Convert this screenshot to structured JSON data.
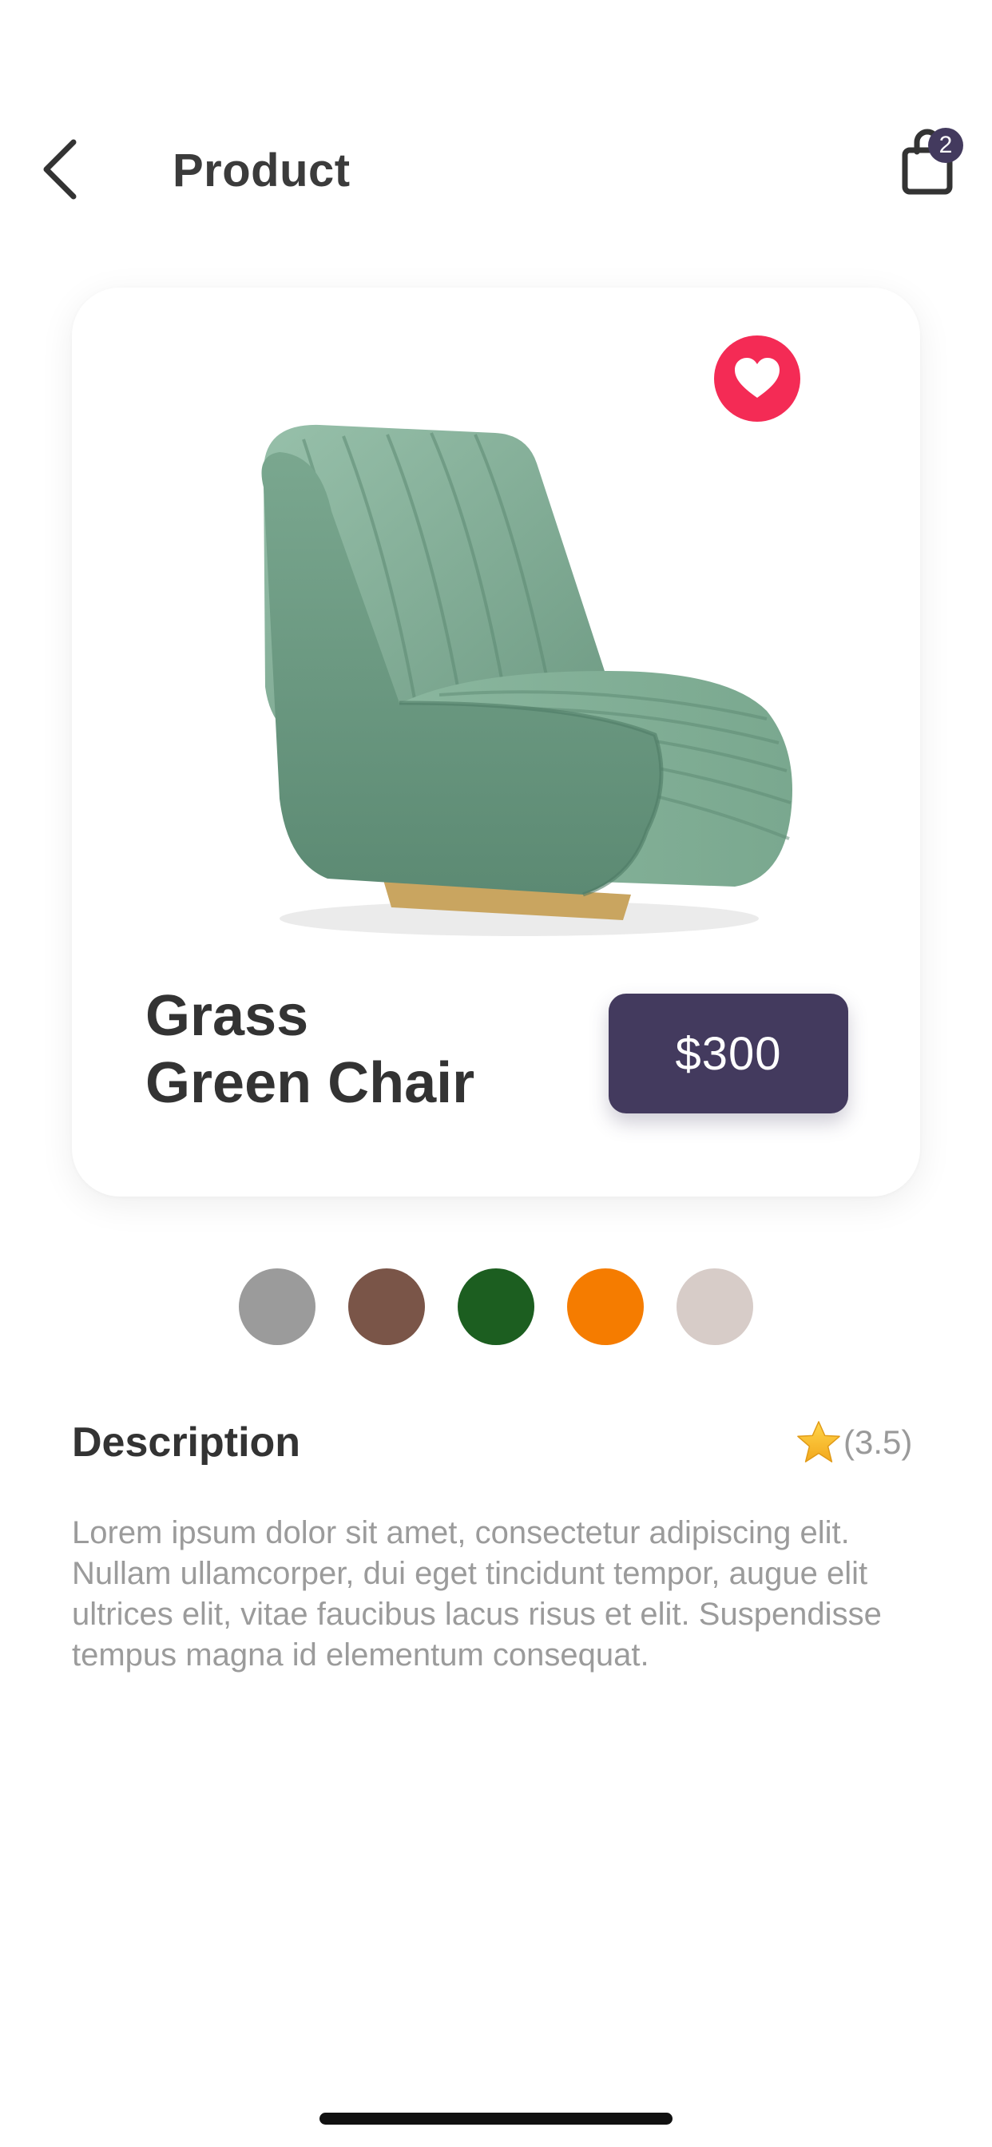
{
  "header": {
    "title": "Product",
    "cart_count": "2",
    "back_icon": "chevron-left-icon",
    "cart_icon": "shopping-bag-icon"
  },
  "product": {
    "name_line1": "Grass",
    "name_line2": "Green Chair",
    "price": "$300",
    "favorite_icon": "heart-icon",
    "favorite_color": "#f42b55",
    "image_subject": "green velvet channel-tufted lounge chair"
  },
  "colors": [
    {
      "name": "grey",
      "hex": "#9b9b9b"
    },
    {
      "name": "brown",
      "hex": "#7a5548"
    },
    {
      "name": "green",
      "hex": "#1c5e20"
    },
    {
      "name": "orange",
      "hex": "#f57c00"
    },
    {
      "name": "beige",
      "hex": "#d7ccc8"
    }
  ],
  "description": {
    "title": "Description",
    "rating": "(3.5)",
    "rating_icon": "star-icon",
    "text": "Lorem ipsum dolor sit amet, consectetur adipiscing elit. Nullam ullamcorper, dui eget tincidunt tempor, augue elit ultrices elit, vitae faucibus lacus risus et elit. Suspendisse tempus magna id elementum consequat."
  },
  "theme": {
    "accent": "#433a5e",
    "text_primary": "#333333",
    "text_secondary": "#9b9b9b"
  }
}
